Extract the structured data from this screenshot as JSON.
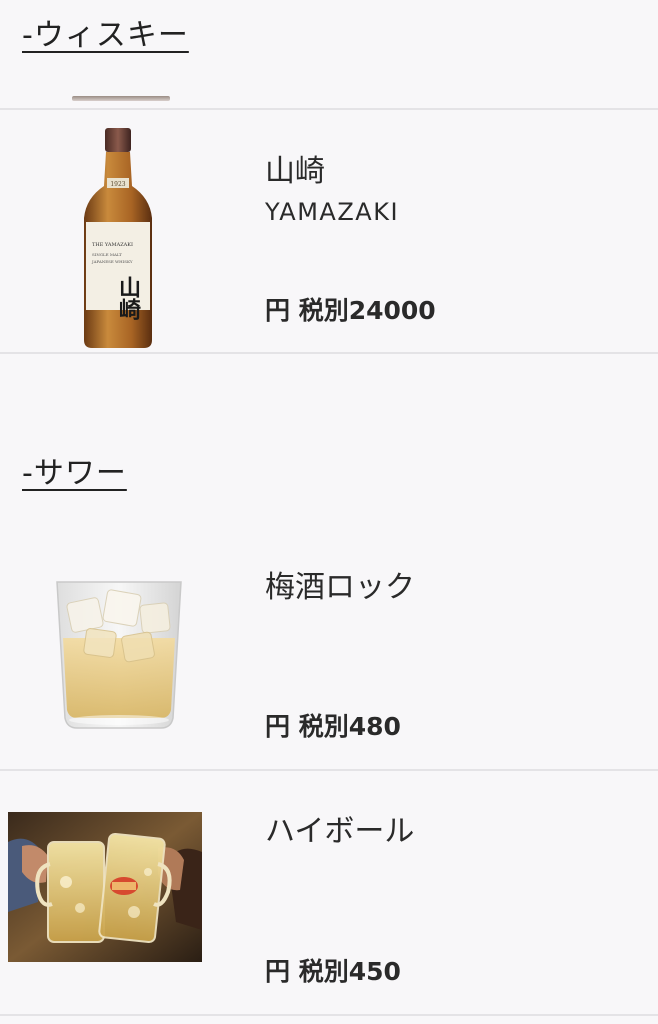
{
  "sections": {
    "whisky": {
      "heading": "-ウィスキー"
    },
    "sour": {
      "heading": "-サワー"
    }
  },
  "items": [
    {
      "name": "山崎",
      "subtitle": "YAMAZAKI",
      "price": "円 税別24000",
      "image": "yamazaki-bottle"
    },
    {
      "name": "梅酒ロック",
      "price": "円 税別480",
      "image": "umeshu-rock-glass"
    },
    {
      "name": "ハイボール",
      "price": "円 税別450",
      "image": "highball-toast-photo"
    }
  ],
  "bottle_label": {
    "brand": "THE YAMAZAKI",
    "line1": "SINGLE MALT",
    "line2": "JAPANESE WHISKY",
    "kanji": "山崎",
    "neck": "1923"
  },
  "colors": {
    "background": "#f8f7f9",
    "text": "#222222",
    "divider": "#e4e3e6"
  }
}
